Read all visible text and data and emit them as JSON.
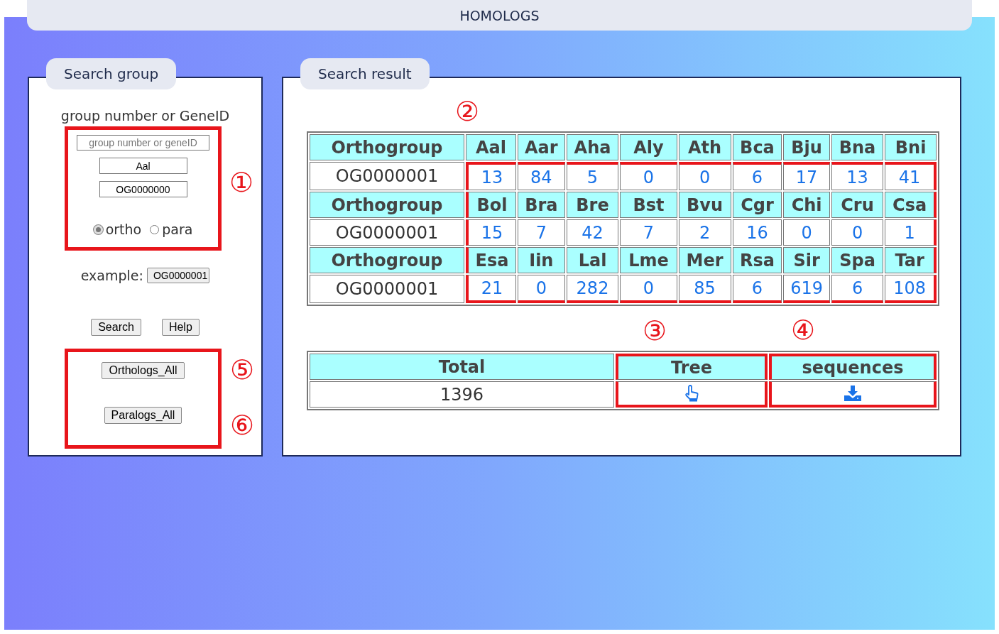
{
  "header": {
    "title": "HOMOLOGS"
  },
  "search_panel": {
    "tab": "Search group",
    "label": "group number or GeneID",
    "query_field": {
      "placeholder": "group number or geneID"
    },
    "species_field": {
      "value": "Aal"
    },
    "group_field": {
      "value": "OG0000000"
    },
    "radios": [
      {
        "label": "ortho",
        "selected": true
      },
      {
        "label": "para",
        "selected": false
      }
    ],
    "example_label": "example:",
    "example_button": "OG0000001",
    "buttons": [
      "Search",
      "Help"
    ],
    "bulk_buttons": [
      "Orthologs_All",
      "Paralogs_All"
    ]
  },
  "result_panel": {
    "tab": "Search result",
    "blocks": [
      {
        "header": "Orthogroup",
        "group": "OG0000001",
        "species": [
          "Aal",
          "Aar",
          "Aha",
          "Aly",
          "Ath",
          "Bca",
          "Bju",
          "Bna",
          "Bni"
        ],
        "counts": [
          "13",
          "84",
          "5",
          "0",
          "0",
          "6",
          "17",
          "13",
          "41"
        ]
      },
      {
        "header": "Orthogroup",
        "group": "OG0000001",
        "species": [
          "Bol",
          "Bra",
          "Bre",
          "Bst",
          "Bvu",
          "Cgr",
          "Chi",
          "Cru",
          "Csa"
        ],
        "counts": [
          "15",
          "7",
          "42",
          "7",
          "2",
          "16",
          "0",
          "0",
          "1"
        ]
      },
      {
        "header": "Orthogroup",
        "group": "OG0000001",
        "species": [
          "Esa",
          "Iin",
          "Lal",
          "Lme",
          "Mer",
          "Rsa",
          "Sir",
          "Spa",
          "Tar"
        ],
        "counts": [
          "21",
          "0",
          "282",
          "0",
          "85",
          "6",
          "619",
          "6",
          "108"
        ]
      }
    ],
    "summary": {
      "columns": [
        "Total",
        "Tree",
        "sequences"
      ],
      "total": "1396"
    }
  },
  "annotations": [
    "①",
    "②",
    "③",
    "④",
    "⑤",
    "⑥"
  ]
}
